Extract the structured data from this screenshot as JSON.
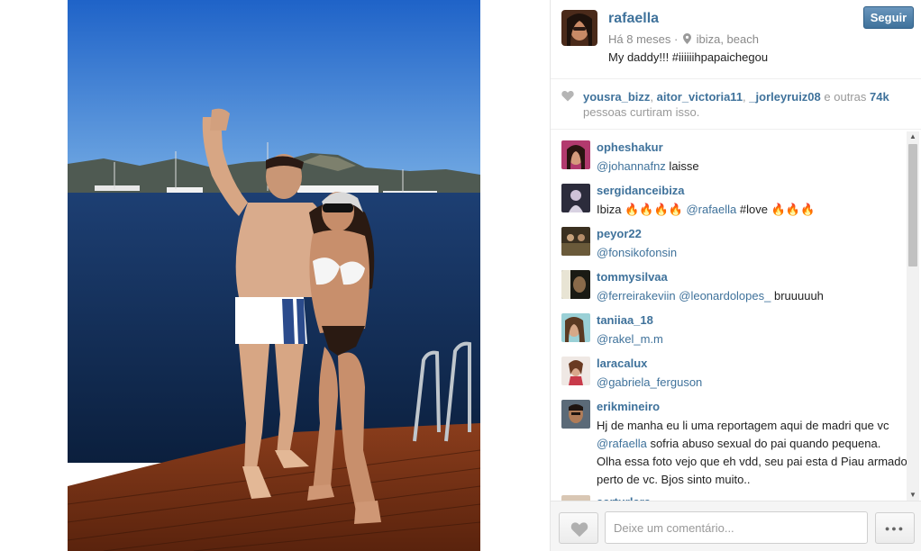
{
  "post": {
    "username": "rafaella",
    "time": "Há 8 meses",
    "separator": "·",
    "location": "ibiza, beach",
    "caption": "My daddy!!! #iiiiiihpapaichegou",
    "follow_label": "Seguir"
  },
  "likes": {
    "users": [
      "yousra_bizz",
      "aitor_victoria11",
      "_jorleyruiz08"
    ],
    "comma": ", ",
    "and_others": " e outras ",
    "count": "74k",
    "suffix": "pessoas curtiram isso."
  },
  "comments": [
    {
      "user": "opheshakur",
      "parts": [
        {
          "mention": "@johannafnz"
        },
        {
          "text": " laisse"
        }
      ]
    },
    {
      "user": "sergidanceibiza",
      "parts": [
        {
          "text": "Ibiza 🔥🔥🔥🔥 "
        },
        {
          "mention": "@rafaella"
        },
        {
          "text": " #love 🔥🔥🔥"
        }
      ]
    },
    {
      "user": "peyor22",
      "parts": [
        {
          "mention": "@fonsikofonsin"
        }
      ]
    },
    {
      "user": "tommysilvaa",
      "parts": [
        {
          "mention": "@ferreirakeviin"
        },
        {
          "text": " "
        },
        {
          "mention": "@leonardolopes_"
        },
        {
          "text": " bruuuuuh"
        }
      ]
    },
    {
      "user": "taniiaa_18",
      "parts": [
        {
          "mention": "@rakel_m.m"
        }
      ]
    },
    {
      "user": "laracalux",
      "parts": [
        {
          "mention": "@gabriela_ferguson"
        }
      ]
    },
    {
      "user": "erikmineiro",
      "parts": [
        {
          "text": "Hj de manha eu li uma reportagem aqui de madri que vc "
        },
        {
          "mention": "@rafaella"
        },
        {
          "text": " sofria abuso sexual do pai quando pequena. Olha essa foto vejo que eh vdd, seu pai esta d Piau armado perto de vc. Bjos sinto muito.."
        }
      ]
    },
    {
      "user": "aarturlara",
      "parts": []
    }
  ],
  "comment_box": {
    "placeholder": "Deixe um comentário...",
    "more_label": "●●●"
  },
  "icons": {
    "location": "pin-icon",
    "heart": "heart-icon",
    "options": "ellipsis-icon"
  },
  "colors": {
    "link": "#3f729b",
    "follow_button": "#3f729b",
    "muted": "#8a8a8a"
  }
}
